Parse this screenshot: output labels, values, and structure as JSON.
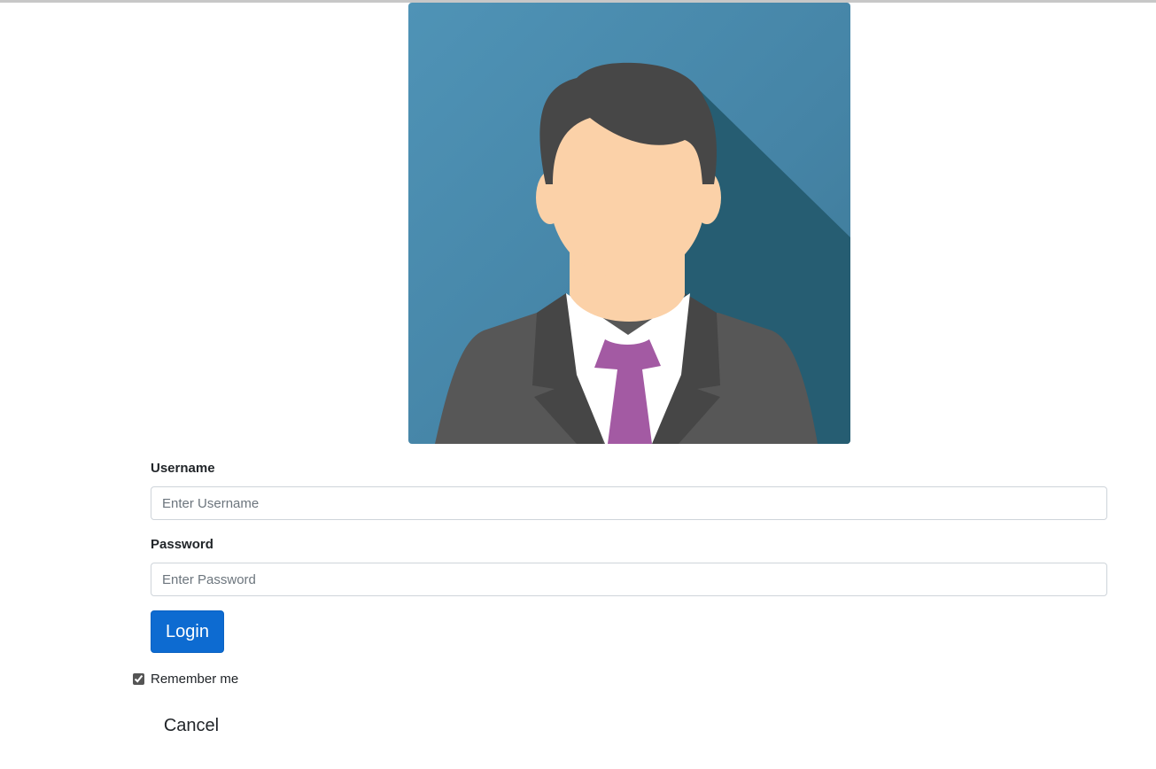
{
  "avatar": {
    "icon": "businessman-avatar"
  },
  "form": {
    "username_label": "Username",
    "username_placeholder": "Enter Username",
    "username_value": "",
    "password_label": "Password",
    "password_placeholder": "Enter Password",
    "password_value": "",
    "login_label": "Login",
    "remember_label": "Remember me",
    "remember_checked": true,
    "cancel_label": "Cancel"
  },
  "colors": {
    "login_button": "#0d6bd1",
    "avatar_background": "#4b8db0",
    "avatar_shadow": "#265d72",
    "tie": "#a35aa3"
  }
}
